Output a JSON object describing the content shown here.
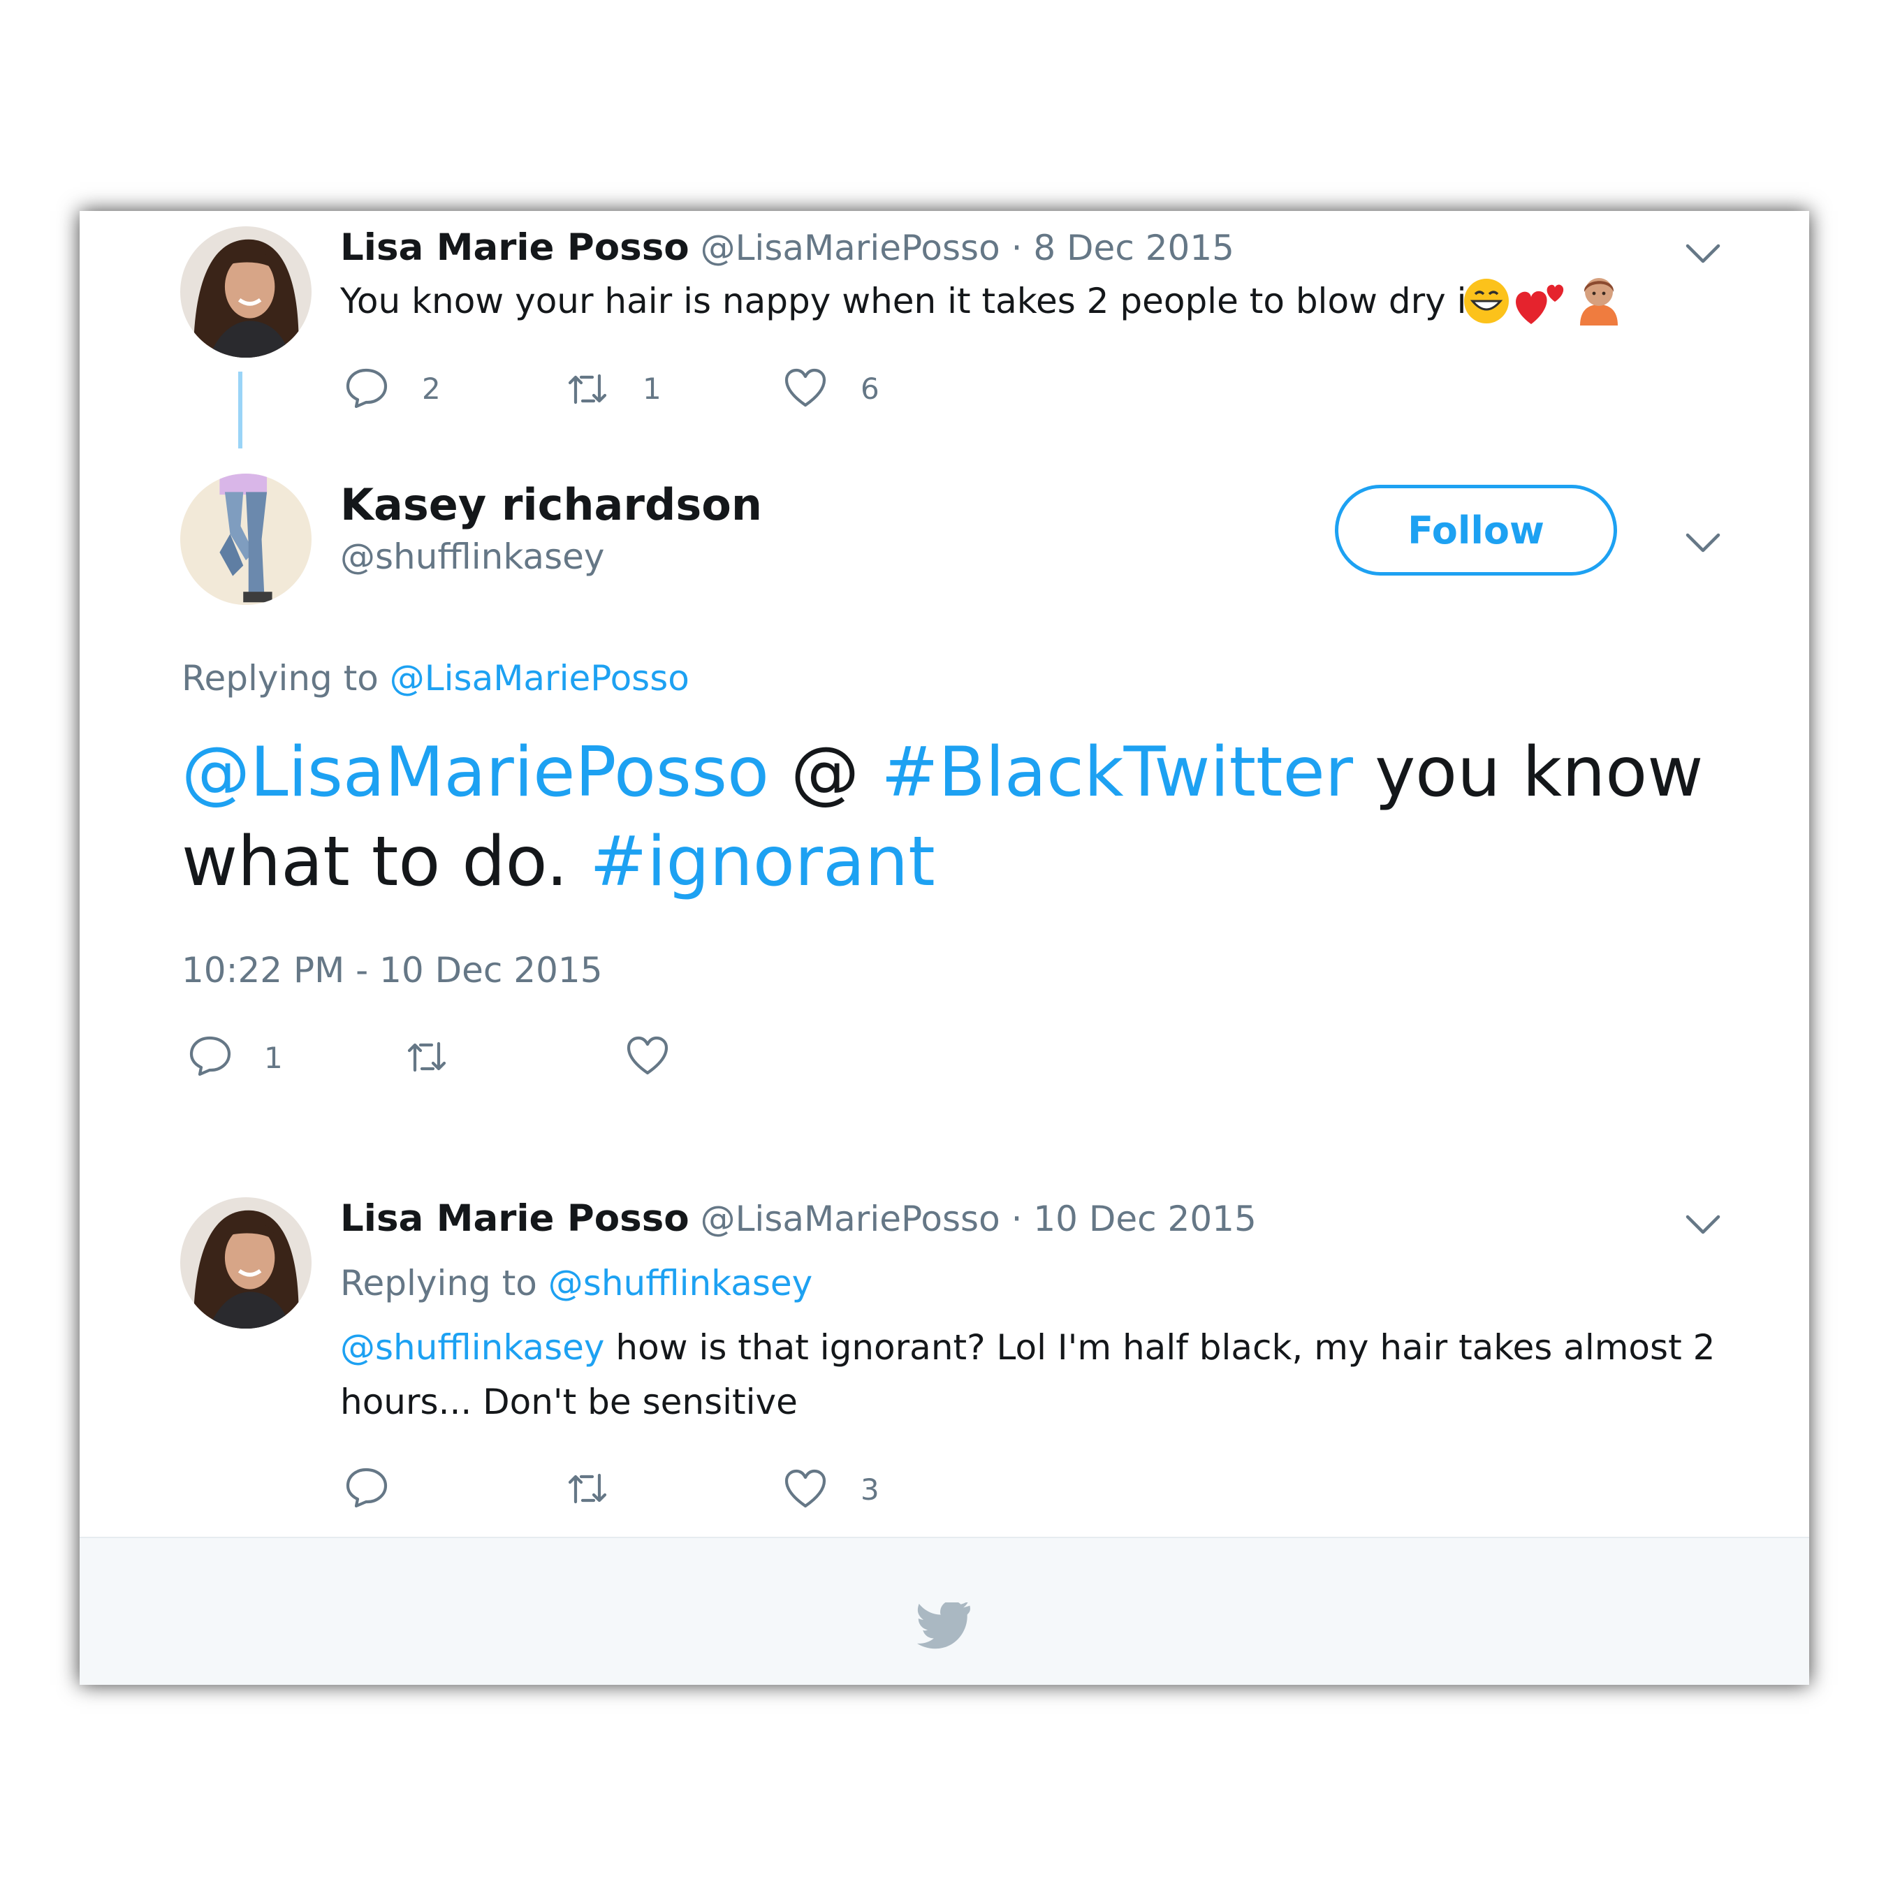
{
  "tweet1": {
    "name": "Lisa Marie Posso",
    "handle": "@LisaMariePosso",
    "date": "· 8 Dec 2015",
    "text": "You know your hair is nappy when it takes 2 people to blow dry it.",
    "emoji": [
      "grinning-face",
      "two-hearts",
      "person-tipping-hand"
    ],
    "replies": "2",
    "retweets": "1",
    "likes": "6"
  },
  "tweet2": {
    "name": "Kasey richardson",
    "handle": "@shufflinkasey",
    "follow_label": "Follow",
    "replying_prefix": "Replying to",
    "replying_to": "@LisaMariePosso",
    "text_parts": {
      "mention": "@LisaMariePosso",
      "at": "@",
      "hashtag1": "#BlackTwitter",
      "middle": "you know what to do.",
      "hashtag2": "#ignorant"
    },
    "timestamp": "10:22 PM - 10 Dec 2015",
    "replies": "1"
  },
  "tweet3": {
    "name": "Lisa Marie Posso",
    "handle": "@LisaMariePosso",
    "date": "· 10 Dec 2015",
    "replying_prefix": "Replying to",
    "replying_to": "@shufflinkasey",
    "mention": "@shufflinkasey",
    "text_line1": "how is that ignorant? Lol I'm half black, my hair takes almost 2",
    "text_line2": "hours... Don't be sensitive",
    "likes": "3"
  },
  "colors": {
    "accent": "#1da1f2",
    "muted": "#657786",
    "text": "#14171a",
    "footer_bg": "#f5f8fa"
  },
  "icons": [
    "reply-icon",
    "retweet-icon",
    "like-icon",
    "chevron-down-icon",
    "twitter-bird-icon"
  ]
}
